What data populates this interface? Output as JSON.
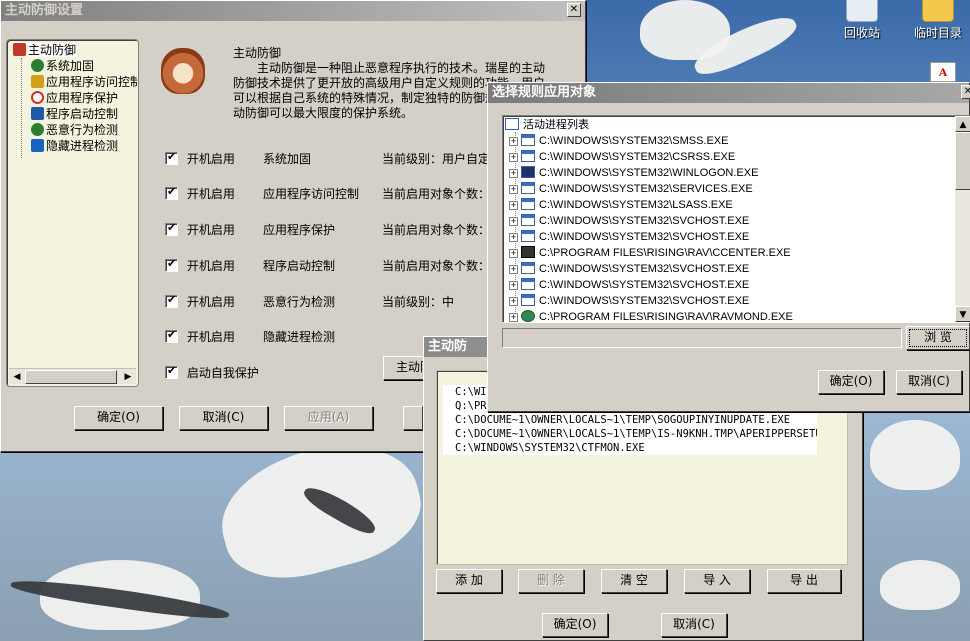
{
  "desktop": {
    "icons": [
      {
        "label": "回收站",
        "icon": "recycle-bin-icon"
      },
      {
        "label": "临时目录",
        "icon": "folder-icon"
      }
    ]
  },
  "main_window": {
    "title": "主动防御设置",
    "tree": [
      {
        "label": "主动防御",
        "icon": "shield-icon",
        "color": "#c0392b"
      },
      {
        "label": "系统加固",
        "icon": "globe-icon",
        "color": "#2e7d32"
      },
      {
        "label": "应用程序访问控制",
        "icon": "folder-icon",
        "color": "#d4a017"
      },
      {
        "label": "应用程序保护",
        "icon": "forbidden-icon",
        "color": "#d32f2f"
      },
      {
        "label": "程序启动控制",
        "icon": "window-icon",
        "color": "#1e5aa8"
      },
      {
        "label": "恶意行为检测",
        "icon": "virus-icon",
        "color": "#2e7d32"
      },
      {
        "label": "隐藏进程检测",
        "icon": "process-icon",
        "color": "#1565c0"
      }
    ],
    "description_title": "主动防御",
    "description_text": "主动防御是一种阻止恶意程序执行的技术。瑞星的主动防御技术提供了更开放的高级用户自定义规则的功能，用户可以根据自己系统的特殊情况，制定独特的防御规则，使主动防御可以最大限度的保护系统。",
    "rows": [
      {
        "checkbox": "开机启用",
        "name": "系统加固",
        "status": "当前级别：用户自定"
      },
      {
        "checkbox": "开机启用",
        "name": "应用程序访问控制",
        "status": "当前启用对象个数："
      },
      {
        "checkbox": "开机启用",
        "name": "应用程序保护",
        "status": "当前启用对象个数："
      },
      {
        "checkbox": "开机启用",
        "name": "程序启动控制",
        "status": "当前启用对象个数："
      },
      {
        "checkbox": "开机启用",
        "name": "恶意行为检测",
        "status": "当前级别：中"
      },
      {
        "checkbox": "开机启用",
        "name": "隐藏进程检测",
        "status": ""
      }
    ],
    "self_protect_label": "启动自我保护",
    "partial_button_label": "主动防",
    "buttons": {
      "ok": "确定(O)",
      "cancel": "取消(C)",
      "apply": "应用(A)"
    }
  },
  "middle_dialog": {
    "title": "主动防",
    "list_items": [
      "C:\\WINDO",
      "Q:\\PROG",
      "C:\\DOCUME~1\\OWNER\\LOCALS~1\\TEMP\\SOGOUPINYINUPDATE.EXE",
      "C:\\DOCUME~1\\OWNER\\LOCALS~1\\TEMP\\IS-N9KNH.TMP\\APERIPPERSETU...",
      "C:\\WINDOWS\\SYSTEM32\\CTFMON.EXE"
    ],
    "buttons": {
      "add": "添 加",
      "delete": "删 除",
      "clear": "清 空",
      "import": "导 入",
      "export": "导 出",
      "ok": "确定(O)",
      "cancel": "取消(C)"
    }
  },
  "top_dialog": {
    "title": "选择规则应用对象",
    "root_label": "活动进程列表",
    "processes": [
      {
        "path": "C:\\WINDOWS\\SYSTEM32\\SMSS.EXE",
        "icon": "window-icon"
      },
      {
        "path": "C:\\WINDOWS\\SYSTEM32\\CSRSS.EXE",
        "icon": "window-icon"
      },
      {
        "path": "C:\\WINDOWS\\SYSTEM32\\WINLOGON.EXE",
        "icon": "winlogon-icon"
      },
      {
        "path": "C:\\WINDOWS\\SYSTEM32\\SERVICES.EXE",
        "icon": "window-icon"
      },
      {
        "path": "C:\\WINDOWS\\SYSTEM32\\LSASS.EXE",
        "icon": "window-icon"
      },
      {
        "path": "C:\\WINDOWS\\SYSTEM32\\SVCHOST.EXE",
        "icon": "window-icon"
      },
      {
        "path": "C:\\WINDOWS\\SYSTEM32\\SVCHOST.EXE",
        "icon": "window-icon"
      },
      {
        "path": "C:\\PROGRAM FILES\\RISING\\RAV\\CCENTER.EXE",
        "icon": "rising-icon"
      },
      {
        "path": "C:\\WINDOWS\\SYSTEM32\\SVCHOST.EXE",
        "icon": "window-icon"
      },
      {
        "path": "C:\\WINDOWS\\SYSTEM32\\SVCHOST.EXE",
        "icon": "window-icon"
      },
      {
        "path": "C:\\WINDOWS\\SYSTEM32\\SVCHOST.EXE",
        "icon": "window-icon"
      },
      {
        "path": "C:\\PROGRAM FILES\\RISING\\RAV\\RAVMOND.EXE",
        "icon": "globe-icon"
      }
    ],
    "path_value": "",
    "buttons": {
      "browse": "浏 览",
      "ok": "确定(O)",
      "cancel": "取消(C)"
    }
  }
}
